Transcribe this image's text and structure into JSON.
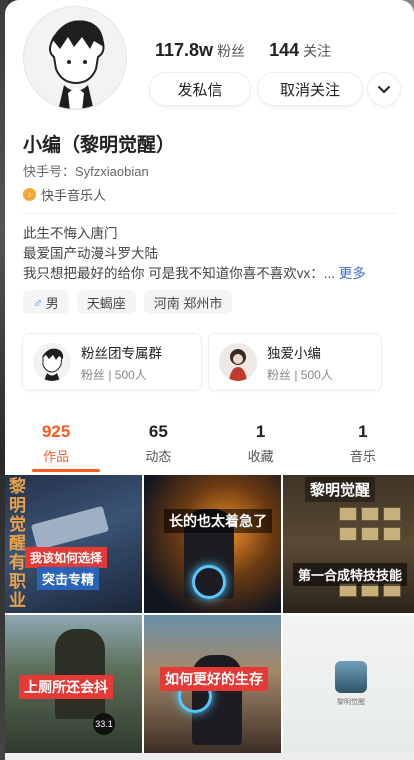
{
  "profile": {
    "followers_count": "117.8w",
    "followers_label": "粉丝",
    "following_count": "144",
    "following_label": "关注",
    "name": "小编（黎明觉醒）",
    "kuaishou_id": "快手号：Syfzxiaobian",
    "badge": "快手音乐人"
  },
  "actions": {
    "message": "发私信",
    "unfollow": "取消关注",
    "more_icon": "chevron-down-icon"
  },
  "bio": {
    "line1": "此生不悔入唐门",
    "line2": "最爱国产动漫斗罗大陆",
    "line3": "我只想把最好的给你 可是我不知道你喜不喜欢vx：...",
    "more": "更多"
  },
  "chips": {
    "gender": "男",
    "gender_icon": "male-icon",
    "zodiac": "天蝎座",
    "location": "河南 郑州市"
  },
  "groups": [
    {
      "title": "粉丝团专属群",
      "sub": "粉丝 | 500人"
    },
    {
      "title": "独爱小编",
      "sub": "粉丝 | 500人"
    }
  ],
  "tabs": [
    {
      "count": "925",
      "label": "作品"
    },
    {
      "count": "65",
      "label": "动态"
    },
    {
      "count": "1",
      "label": "收藏"
    },
    {
      "count": "1",
      "label": "音乐"
    }
  ],
  "videos": [
    {
      "vertical": "黎明觉醒有职业",
      "caption1": "我该如何选择",
      "caption2": "突击专精"
    },
    {
      "caption": "长的也太着急了"
    },
    {
      "title": "黎明觉醒",
      "caption": "第一合成特技技能"
    },
    {
      "caption": "上厕所还会抖",
      "badge": "33.1"
    },
    {
      "caption": "如何更好的生存"
    },
    {
      "app_name": "黎明觉醒"
    }
  ],
  "colors": {
    "accent": "#ff5a1f",
    "link": "#3a6bd3",
    "caption_red": "#e53935"
  }
}
